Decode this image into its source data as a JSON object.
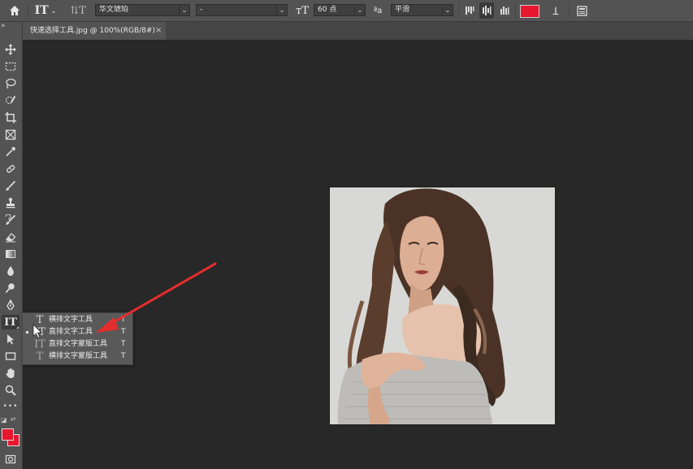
{
  "options_bar": {
    "font_family": "华文琥珀",
    "font_style": "-",
    "font_size": "60 点",
    "antialias": "平滑",
    "text_color": "#e8162e",
    "icons": [
      "home-icon",
      "text-tool-preset-icon",
      "text-orientation-toggle-icon",
      "font-size-icon",
      "antialias-icon",
      "align-left-icon",
      "align-center-icon",
      "align-right-icon",
      "warp-text-icon",
      "character-panel-icon"
    ]
  },
  "document_tab": {
    "title": "快速选择工具.jpg @ 100%(RGB/8#)",
    "close": "×"
  },
  "toolbar": {
    "collapse": "»",
    "more": "•••"
  },
  "flyout": {
    "items": [
      {
        "label": "横排文字工具",
        "shortcut": "T",
        "selected": false
      },
      {
        "label": "直排文字工具",
        "shortcut": "T",
        "selected": true
      },
      {
        "label": "直排文字蒙版工具",
        "shortcut": "T",
        "selected": false
      },
      {
        "label": "横排文字蒙版工具",
        "shortcut": "T",
        "selected": false
      }
    ]
  },
  "colors": {
    "foreground": "#e8162e",
    "background": "#e8162e",
    "arrow_annotation": "#e52d2d"
  }
}
